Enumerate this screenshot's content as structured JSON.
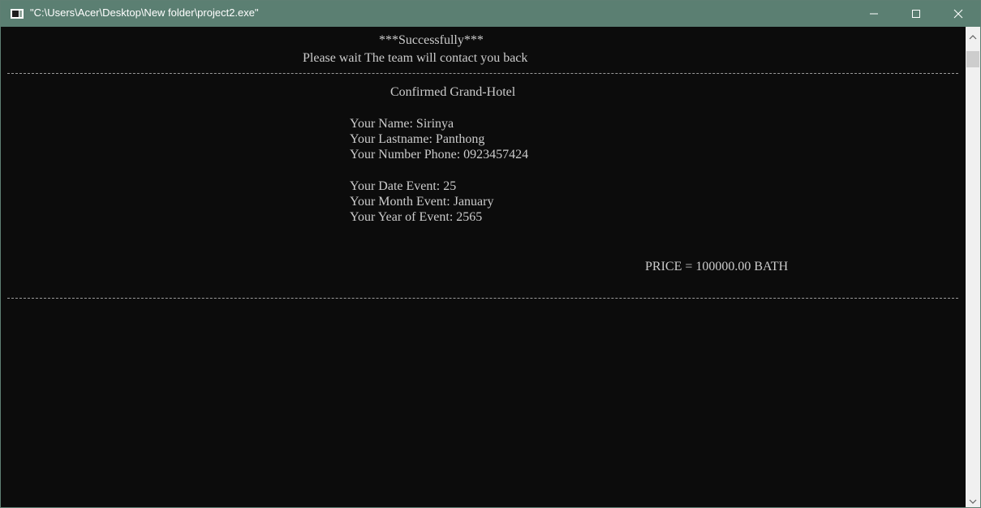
{
  "window": {
    "title": "\"C:\\Users\\Acer\\Desktop\\New folder\\project2.exe\"",
    "icon": "console-app-icon",
    "controls": {
      "minimize_icon": "minimize-icon",
      "maximize_icon": "maximize-icon",
      "close_icon": "close-icon"
    },
    "colors": {
      "titlebar": "#5b7f72",
      "console_bg": "#0c0c0c",
      "console_text": "#cccccc"
    }
  },
  "console": {
    "header": {
      "success": "***Successfully***",
      "message": "Please wait The team will contact you back"
    },
    "confirmation_title": "Confirmed Grand-Hotel",
    "customer": {
      "name_line": "Your Name: Sirinya",
      "lastname_line": "Your Lastname: Panthong",
      "phone_line": "Your Number Phone: 0923457424"
    },
    "event": {
      "date_line": "Your Date Event: 25",
      "month_line": "Your Month Event: January",
      "year_line": "Your Year of Event: 2565"
    },
    "price_line": "PRICE = 100000.00 BATH"
  },
  "scrollbar": {
    "up_icon": "chevron-up-icon",
    "down_icon": "chevron-down-icon"
  }
}
